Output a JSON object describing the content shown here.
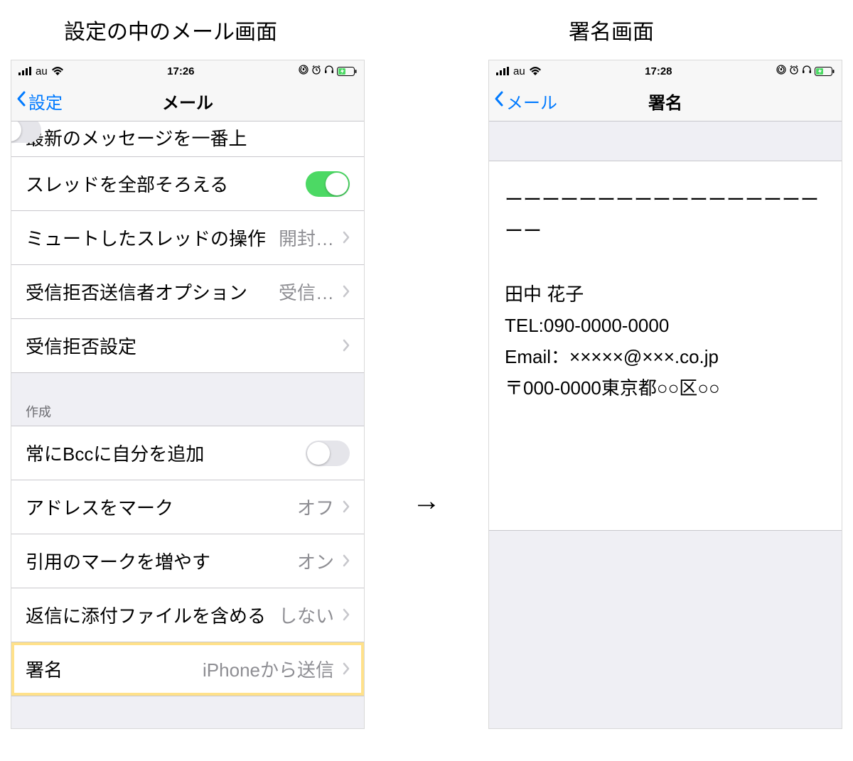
{
  "captions": {
    "left": "設定の中のメール画面",
    "right": "署名画面"
  },
  "arrow": "→",
  "left_phone": {
    "status": {
      "carrier": "au",
      "time": "17:26"
    },
    "nav": {
      "back": "設定",
      "title": "メール"
    },
    "cut_row": {
      "text": "最新のメッセージを一番上",
      "toggle_on": false
    },
    "rows": {
      "thread_complete": {
        "label": "スレッドを全部そろえる",
        "toggle_on": true
      },
      "muted": {
        "label": "ミュートしたスレッドの操作",
        "value": "開封…"
      },
      "blocked_option": {
        "label": "受信拒否送信者オプション",
        "value": "受信…"
      },
      "blocked_settings": {
        "label": "受信拒否設定"
      }
    },
    "section_compose": "作成",
    "rows2": {
      "bcc_self": {
        "label": "常にBccに自分を追加",
        "toggle_on": false
      },
      "mark_address": {
        "label": "アドレスをマーク",
        "value": "オフ"
      },
      "increase_quote": {
        "label": "引用のマークを増やす",
        "value": "オン"
      },
      "include_attach": {
        "label": "返信に添付ファイルを含める",
        "value": "しない"
      },
      "signature": {
        "label": "署名",
        "value": "iPhoneから送信"
      }
    }
  },
  "right_phone": {
    "status": {
      "carrier": "au",
      "time": "17:28"
    },
    "nav": {
      "back": "メール",
      "title": "署名"
    },
    "signature_text": "ーーーーーーーーーーーーーーーーーーー\n\n田中 花子\nTEL:090-0000-0000\nEmail：×××××@×××.co.jp\n〒000-0000東京都○○区○○"
  }
}
